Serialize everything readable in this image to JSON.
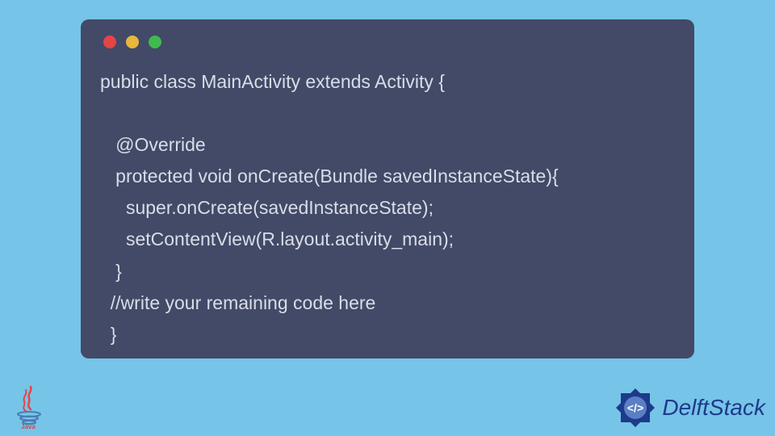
{
  "code": {
    "line1": "public class MainActivity extends Activity {",
    "line2": "",
    "line3": "   @Override",
    "line4": "   protected void onCreate(Bundle savedInstanceState){",
    "line5": "     super.onCreate(savedInstanceState);",
    "line6": "     setContentView(R.layout.activity_main);",
    "line7": "   }",
    "line8": "  //write your remaining code here",
    "line9": "  }"
  },
  "branding": {
    "delftstack": "DelftStack",
    "java_label": "Java"
  }
}
